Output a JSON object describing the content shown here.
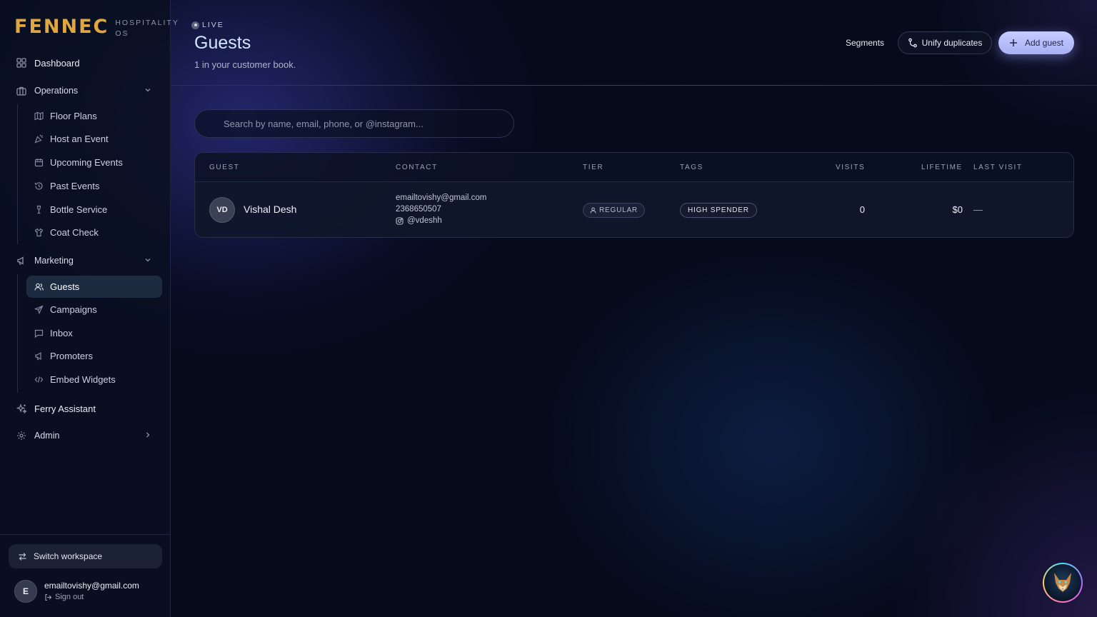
{
  "brand": {
    "logo": "FENNEC",
    "subtitle_line1": "HOSPITALITY",
    "subtitle_line2": "OS"
  },
  "sidebar": {
    "dashboard": "Dashboard",
    "operations": {
      "label": "Operations",
      "items": [
        "Floor Plans",
        "Host an Event",
        "Upcoming Events",
        "Past Events",
        "Bottle Service",
        "Coat Check"
      ]
    },
    "marketing": {
      "label": "Marketing",
      "items": [
        "Guests",
        "Campaigns",
        "Inbox",
        "Promoters",
        "Embed Widgets"
      ],
      "active": "Guests"
    },
    "assistant": "Ferry Assistant",
    "admin": "Admin",
    "switch_workspace": "Switch workspace",
    "user": {
      "initial": "E",
      "email": "emailtovishy@gmail.com",
      "sign_out": "Sign out"
    }
  },
  "header": {
    "live_label": "LIVE",
    "title": "Guests",
    "subtitle": "1 in your customer book.",
    "segments_label": "Segments",
    "unify_label": "Unify duplicates",
    "add_label": "Add guest"
  },
  "search": {
    "placeholder": "Search by name, email, phone, or @instagram..."
  },
  "table": {
    "columns": [
      "GUEST",
      "CONTACT",
      "TIER",
      "TAGS",
      "VISITS",
      "LIFETIME",
      "LAST VISIT"
    ],
    "rows": [
      {
        "initials": "VD",
        "name": "Vishal Desh",
        "email": "emailtovishy@gmail.com",
        "phone": "2368650507",
        "instagram": "@vdeshh",
        "tier": "REGULAR",
        "tag": "HIGH SPENDER",
        "visits": "0",
        "lifetime": "$0",
        "last_visit": "—"
      }
    ]
  },
  "colors": {
    "brand_gold": "#e0a640",
    "accent": "#b9c0fb",
    "background": "#060b1c"
  }
}
